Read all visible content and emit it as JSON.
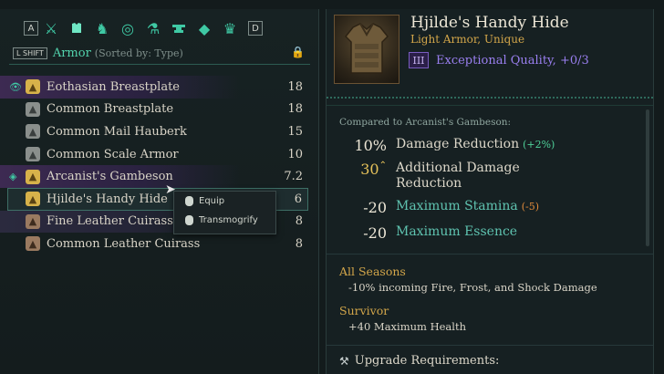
{
  "inventory": {
    "key_prev": "A",
    "key_next": "D",
    "categories": [
      {
        "icon": "crossed-weapons-icon"
      },
      {
        "icon": "armor-icon",
        "active": true
      },
      {
        "icon": "horse-icon"
      },
      {
        "icon": "ring-icon"
      },
      {
        "icon": "potion-icon"
      },
      {
        "icon": "anvil-icon"
      },
      {
        "icon": "gem-icon"
      },
      {
        "icon": "crown-icon"
      }
    ],
    "sort_key": "L SHIFT",
    "sort_label": "Armor",
    "sort_sub": "(Sorted by: Type)",
    "items": [
      {
        "name": "Eothasian Breastplate",
        "value": "18"
      },
      {
        "name": "Common Breastplate",
        "value": "18"
      },
      {
        "name": "Common Mail Hauberk",
        "value": "15"
      },
      {
        "name": "Common Scale Armor",
        "value": "10"
      },
      {
        "name": "Arcanist's Gambeson",
        "value": "7.2"
      },
      {
        "name": "Hjilde's Handy Hide",
        "value": "6"
      },
      {
        "name": "Fine Leather Cuirass",
        "value": "8"
      },
      {
        "name": "Common Leather Cuirass",
        "value": "8"
      }
    ]
  },
  "context_menu": {
    "equip": "Equip",
    "transmogrify": "Transmogrify"
  },
  "detail": {
    "name": "Hjilde's Handy Hide",
    "type": "Light Armor, Unique",
    "quality_badge": "III",
    "quality_text": "Exceptional Quality, +0/3",
    "compare_label": "Compared to Arcanist's Gambeson:",
    "stats": [
      {
        "value": "10%",
        "label": "Damage Reduction",
        "delta": "(+2%)"
      },
      {
        "value": "30",
        "label": "Additional Damage Reduction"
      },
      {
        "value": "-20",
        "label": "Maximum Stamina",
        "delta": "(-5)"
      },
      {
        "value": "-20",
        "label": "Maximum Essence"
      }
    ],
    "enchant1_title": "All Seasons",
    "enchant1_desc": "-10% incoming Fire, Frost, and Shock Damage",
    "enchant2_title": "Survivor",
    "enchant2_desc": "+40 Maximum Health",
    "upgrade_label": "Upgrade Requirements:"
  },
  "colors": {
    "accent": "#3fc9a4",
    "gold": "#d3a64a",
    "quality": "#9a7ff0"
  }
}
